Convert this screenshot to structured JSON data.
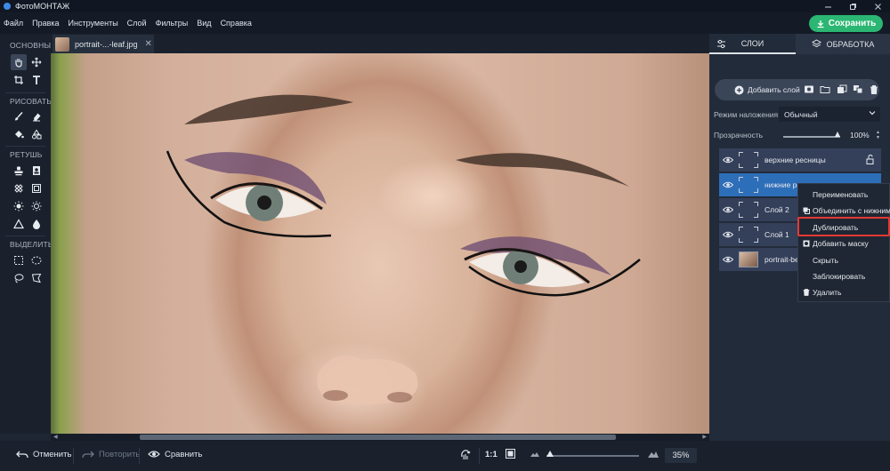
{
  "app": {
    "title": "ФотоМОНТАЖ",
    "save_label": "Сохранить"
  },
  "menu": [
    "Файл",
    "Правка",
    "Инструменты",
    "Слой",
    "Фильтры",
    "Вид",
    "Справка"
  ],
  "toolbar": {
    "sections": {
      "basic": "ОСНОВНЫЕ",
      "draw": "РИСОВАТЬ",
      "retouch": "РЕТУШЬ",
      "select": "ВЫДЕЛИТЬ"
    }
  },
  "document": {
    "tab_name": "portrait-...-leaf.jpg",
    "tab_close": "✕"
  },
  "bottom": {
    "undo": "Отменить",
    "redo": "Повторить",
    "compare": "Сравнить",
    "ratio": "1:1",
    "zoom": "35%",
    "zoom_fraction": 0.04
  },
  "panel": {
    "tabs": {
      "layers": "СЛОИ",
      "processing": "ОБРАБОТКА"
    },
    "add_layer": "Добавить слой",
    "blend_label": "Режим наложения:",
    "blend_value": "Обычный",
    "opacity_label": "Прозрачность",
    "opacity_value": "100%",
    "opacity_fraction": 1.0
  },
  "layers": [
    {
      "name": "верхние ресницы",
      "type": "layer",
      "selected": false
    },
    {
      "name": "нижние ресницы",
      "type": "layer",
      "selected": true
    },
    {
      "name": "Слой 2",
      "type": "layer",
      "selected": false
    },
    {
      "name": "Слой 1",
      "type": "layer",
      "selected": false
    },
    {
      "name": "portrait-be",
      "type": "image",
      "selected": false
    }
  ],
  "context_menu": {
    "items": [
      {
        "label": "Переименовать",
        "icon": ""
      },
      {
        "label": "Объединить с нижним",
        "icon": "merge-icon"
      },
      {
        "label": "Дублировать",
        "icon": "",
        "highlighted": true
      },
      {
        "label": "Добавить маску",
        "icon": "mask-icon"
      },
      {
        "label": "Скрыть",
        "icon": ""
      },
      {
        "label": "Заблокировать",
        "icon": ""
      },
      {
        "label": "Удалить",
        "icon": "trash-icon"
      }
    ]
  },
  "colors": {
    "accent_green": "#2bb673",
    "selection_blue": "#2d6eb8",
    "highlight_red": "#e53935"
  }
}
